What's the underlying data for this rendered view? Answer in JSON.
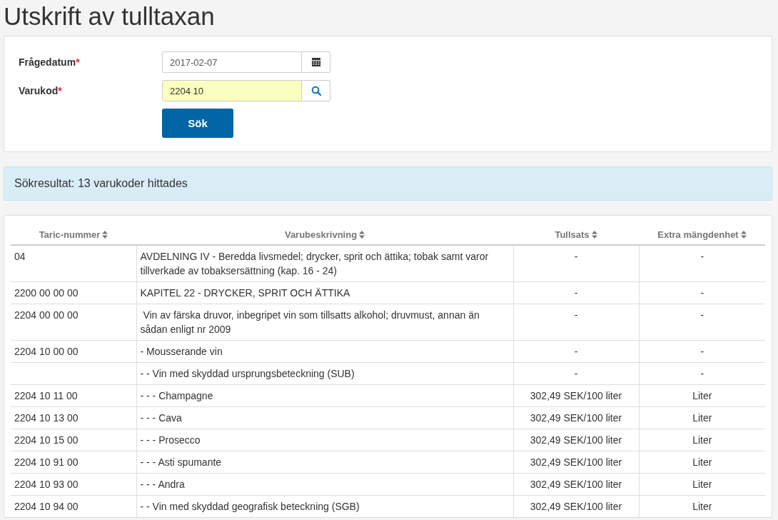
{
  "title": "Utskrift av tulltaxan",
  "form": {
    "fields": [
      {
        "kind": "date",
        "label": "Frågedatum",
        "required": "*",
        "value": "2017-02-07",
        "highlighted": false
      },
      {
        "kind": "search",
        "label": "Varukod",
        "required": "*",
        "value": "2204 10",
        "highlighted": true
      }
    ],
    "submit": "Sök"
  },
  "alert": "Sökresultat: 13 varukoder hittades",
  "table": {
    "columns": [
      "Taric-nummer",
      "Varubeskrivning",
      "Tullsats",
      "Extra mängdenhet"
    ],
    "rows": [
      [
        "04",
        "AVDELNING IV - Beredda livsmedel; drycker, sprit och ättika; tobak samt varor tillverkade av tobaksersättning (kap. 16 - 24)",
        "-",
        "-"
      ],
      [
        "2200 00 00 00",
        "KAPITEL 22 - DRYCKER, SPRIT OCH ÄTTIKA",
        "-",
        "-"
      ],
      [
        "2204 00 00 00",
        " Vin av färska druvor, inbegripet vin som tillsatts alkohol; druvmust, annan än sådan enligt nr 2009",
        "-",
        "-"
      ],
      [
        "2204 10 00 00",
        "- Mousserande vin",
        "-",
        "-"
      ],
      [
        "",
        "- - Vin med skyddad ursprungsbeteckning (SUB)",
        "-",
        "-"
      ],
      [
        "2204 10 11 00",
        "- - - Champagne",
        "302,49 SEK/100 liter",
        "Liter"
      ],
      [
        "2204 10 13 00",
        "- - - Cava",
        "302,49 SEK/100 liter",
        "Liter"
      ],
      [
        "2204 10 15 00",
        "- - - Prosecco",
        "302,49 SEK/100 liter",
        "Liter"
      ],
      [
        "2204 10 91 00",
        "- - - Asti spumante",
        "302,49 SEK/100 liter",
        "Liter"
      ],
      [
        "2204 10 93 00",
        "- - - Andra",
        "302,49 SEK/100 liter",
        "Liter"
      ],
      [
        "2204 10 94 00",
        "- - Vin med skyddad geografisk beteckning (SGB)",
        "302,49 SEK/100 liter",
        "Liter"
      ]
    ]
  }
}
